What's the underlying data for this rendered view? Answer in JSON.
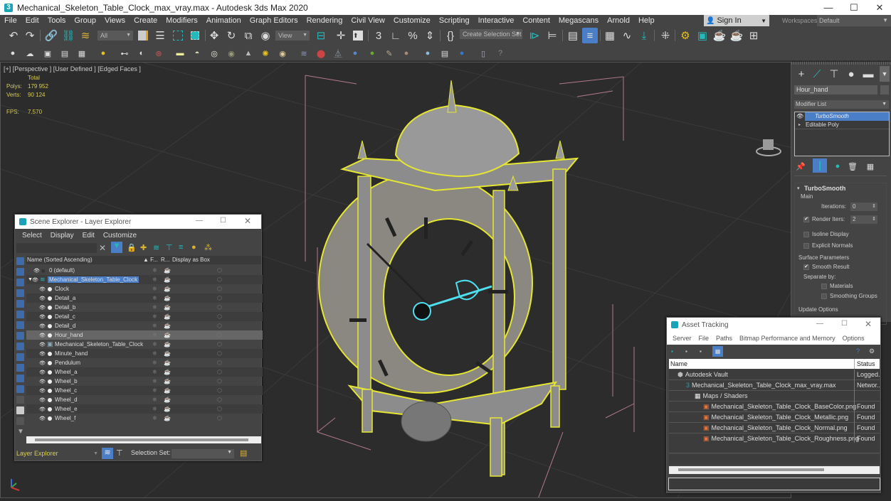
{
  "title_bar": {
    "app_icon": "3",
    "title": "Mechanical_Skeleton_Table_Clock_max_vray.max - Autodesk 3ds Max 2020",
    "minimize": "—",
    "maximize": "☐",
    "close": "✕"
  },
  "menu": {
    "items": [
      "File",
      "Edit",
      "Tools",
      "Group",
      "Views",
      "Create",
      "Modifiers",
      "Animation",
      "Graph Editors",
      "Rendering",
      "Civil View",
      "Customize",
      "Scripting",
      "Interactive",
      "Content",
      "Megascans",
      "Arnold",
      "Help"
    ],
    "sign_in": "Sign In",
    "workspaces_label": "Workspaces:",
    "workspace_value": "Default"
  },
  "toolbar": {
    "selection_filter": "All",
    "reference_coord": "View",
    "named_selection_set": "Create Selection Set",
    "main_icons": [
      "undo-icon",
      "redo-icon",
      "link-icon",
      "unlink-icon",
      "bind-space-warp-icon",
      "select-object-icon",
      "select-by-name-icon",
      "rect-selection-icon",
      "window-crossing-icon",
      "move-icon",
      "rotate-icon",
      "scale-icon",
      "placement-icon",
      "use-pivot-icon",
      "select-manipulate-icon",
      "keyboard-shortcut-icon",
      "snaps-3d-icon",
      "angle-snap-icon",
      "percent-snap-icon",
      "spinner-snap-icon",
      "edit-named-sets-icon",
      "mirror-icon",
      "align-icon",
      "layer-explorer-icon",
      "toggle-scene-explorer-icon",
      "ribbon-icon",
      "curve-editor-icon",
      "schematic-view-icon",
      "material-editor-icon",
      "render-setup-icon",
      "rendered-frame-icon",
      "render-production-icon",
      "render-iterative-icon",
      "render-online-icon"
    ],
    "secondary_icons": 33
  },
  "viewport": {
    "label": "[+] [Perspective ] [User Defined ] [Edged Faces ]",
    "stats": {
      "total_label": "Total",
      "polys_label": "Polys:",
      "polys_value": "179 952",
      "verts_label": "Verts:",
      "verts_value": "90 124",
      "fps_label": "FPS:",
      "fps_value": "7.570"
    }
  },
  "scene_explorer": {
    "title": "Scene Explorer - Layer Explorer",
    "menu": [
      "Select",
      "Display",
      "Edit",
      "Customize"
    ],
    "columns": {
      "name": "Name (Sorted Ascending)",
      "frozen": "▲ F...",
      "render": "R...",
      "display_box": "Display as Box"
    },
    "rows": [
      {
        "name": "0 (default)",
        "level": 1,
        "type": "layer-default"
      },
      {
        "name": "Mechanical_Skeleton_Table_Clock",
        "level": 0,
        "type": "layer-active",
        "selected": true
      },
      {
        "name": "Clock",
        "level": 2,
        "type": "object"
      },
      {
        "name": "Detail_a",
        "level": 2,
        "type": "object"
      },
      {
        "name": "Detail_b",
        "level": 2,
        "type": "object"
      },
      {
        "name": "Detail_c",
        "level": 2,
        "type": "object"
      },
      {
        "name": "Detail_d",
        "level": 2,
        "type": "object"
      },
      {
        "name": "Hour_hand",
        "level": 2,
        "type": "object",
        "highlighted": true
      },
      {
        "name": "Mechanical_Skeleton_Table_Clock",
        "level": 2,
        "type": "group"
      },
      {
        "name": "Minute_hand",
        "level": 2,
        "type": "object"
      },
      {
        "name": "Pendulum",
        "level": 2,
        "type": "object"
      },
      {
        "name": "Wheel_a",
        "level": 2,
        "type": "object"
      },
      {
        "name": "Wheel_b",
        "level": 2,
        "type": "object"
      },
      {
        "name": "Wheel_c",
        "level": 2,
        "type": "object"
      },
      {
        "name": "Wheel_d",
        "level": 2,
        "type": "object"
      },
      {
        "name": "Wheel_e",
        "level": 2,
        "type": "object"
      },
      {
        "name": "Wheel_f",
        "level": 2,
        "type": "object"
      }
    ],
    "footer": {
      "explorer_select": "Layer Explorer",
      "selection_set_label": "Selection Set:",
      "selection_set_value": ""
    }
  },
  "command_panel": {
    "object_name": "Hour_hand",
    "modifier_list_label": "Modifier List",
    "modifier_stack": [
      {
        "name": "TurboSmooth",
        "selected": true
      },
      {
        "name": "Editable Poly",
        "selected": false
      }
    ],
    "rollout": {
      "title": "TurboSmooth",
      "main_group": "Main",
      "iterations_label": "Iterations:",
      "iterations_value": "0",
      "render_iters_label": "Render Iters:",
      "render_iters_value": "2",
      "render_iters_checked": true,
      "isoline_display": "Isoline Display",
      "isoline_checked": false,
      "explicit_normals": "Explicit Normals",
      "explicit_normals_checked": false,
      "surface_group": "Surface Parameters",
      "smooth_result": "Smooth Result",
      "smooth_result_checked": true,
      "separate_by": "Separate by:",
      "materials": "Materials",
      "materials_checked": false,
      "smoothing_groups": "Smoothing Groups",
      "smoothing_groups_checked": false,
      "update_options": "Update Options"
    }
  },
  "asset_tracking": {
    "title": "Asset Tracking",
    "menu": [
      "Server",
      "File",
      "Paths",
      "Bitmap Performance and Memory",
      "Options"
    ],
    "columns": {
      "name": "Name",
      "status": "Status"
    },
    "rows": [
      {
        "name": "Autodesk Vault",
        "status": "Logged...",
        "level": 1,
        "icon": "vault-icon"
      },
      {
        "name": "Mechanical_Skeleton_Table_Clock_max_vray.max",
        "status": "Networ...",
        "level": 2,
        "icon": "max-file-icon"
      },
      {
        "name": "Maps / Shaders",
        "status": "",
        "level": 3,
        "icon": "maps-folder-icon"
      },
      {
        "name": "Mechanical_Skeleton_Table_Clock_BaseColor.png",
        "status": "Found",
        "level": 4,
        "icon": "png-icon"
      },
      {
        "name": "Mechanical_Skeleton_Table_Clock_Metallic.png",
        "status": "Found",
        "level": 4,
        "icon": "png-icon"
      },
      {
        "name": "Mechanical_Skeleton_Table_Clock_Normal.png",
        "status": "Found",
        "level": 4,
        "icon": "png-icon"
      },
      {
        "name": "Mechanical_Skeleton_Table_Clock_Roughness.png",
        "status": "Found",
        "level": 4,
        "icon": "png-icon"
      }
    ]
  },
  "colors": {
    "selection_outline": "#e6e633",
    "subobject_highlight": "#4fe0f0",
    "accent_blue": "#4a7ec7",
    "stats_text": "#d7cd54"
  }
}
